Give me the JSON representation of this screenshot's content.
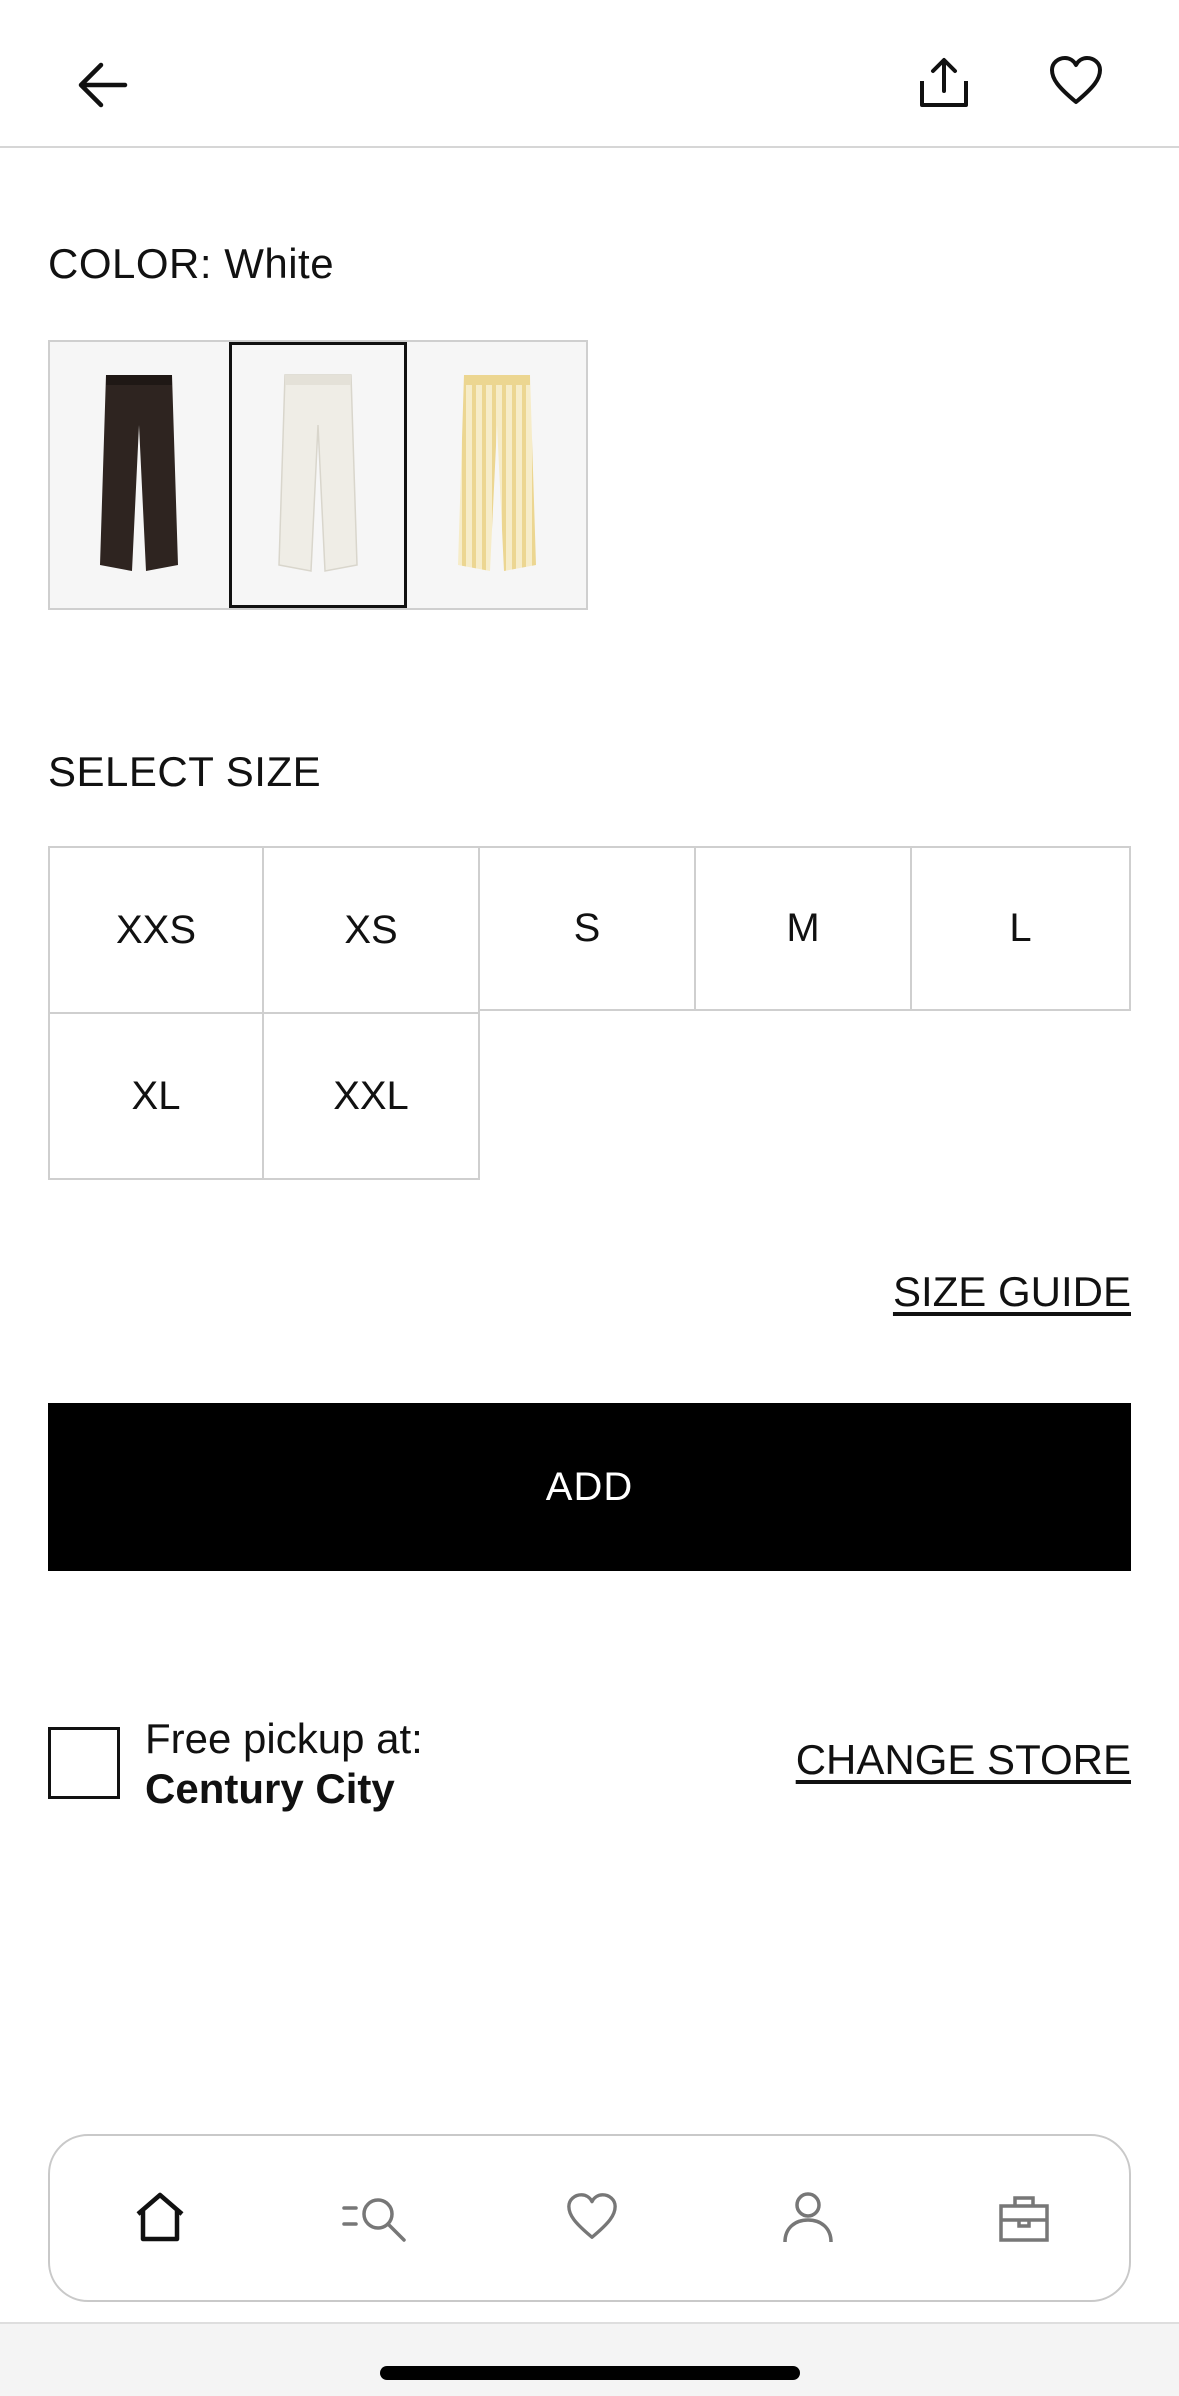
{
  "header": {
    "back_icon": "arrow-left-icon",
    "share_icon": "share-icon",
    "favorite_icon": "heart-icon"
  },
  "color": {
    "label": "COLOR: White",
    "swatches": [
      {
        "name": "Brown",
        "color": "#2e2420",
        "selected": false
      },
      {
        "name": "White",
        "color": "#efede6",
        "selected": true
      },
      {
        "name": "Yellow stripe",
        "color": "#f1e2ad",
        "selected": false
      }
    ]
  },
  "sizes": {
    "label": "SELECT SIZE",
    "options": [
      "XXS",
      "XS",
      "S",
      "M",
      "L",
      "XL",
      "XXL"
    ]
  },
  "size_guide": "SIZE GUIDE",
  "add_button": "ADD",
  "pickup": {
    "line1": "Free pickup at:",
    "store": "Century City",
    "change_store": "CHANGE STORE"
  },
  "bottom_nav": {
    "items": [
      "home-icon",
      "search-icon",
      "heart-icon",
      "account-icon",
      "bag-icon"
    ]
  }
}
